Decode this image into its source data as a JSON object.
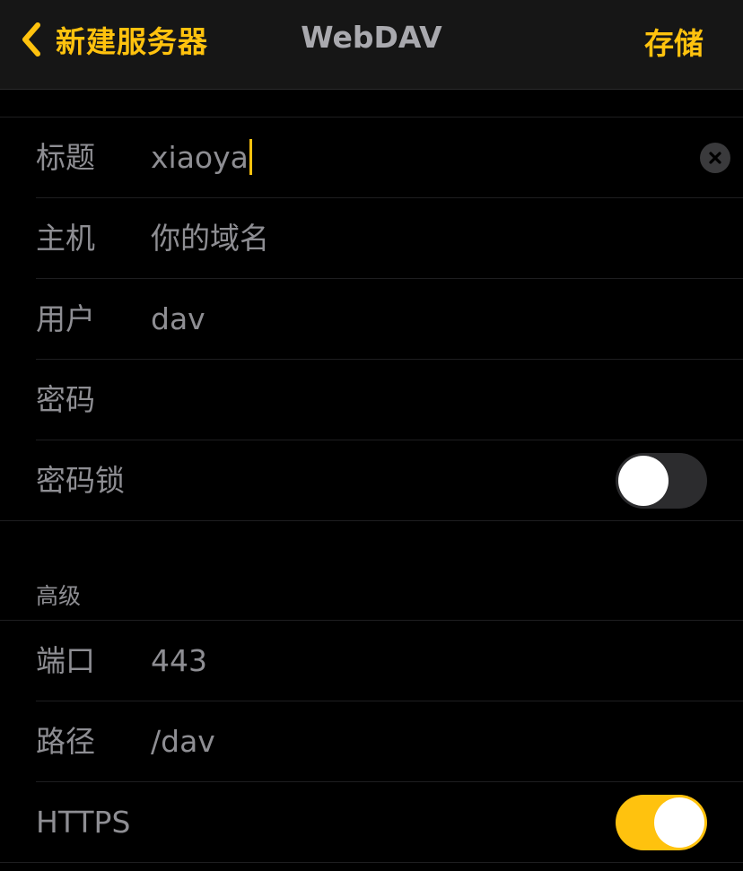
{
  "navbar": {
    "back_label": "新建服务器",
    "title": "WebDAV",
    "save_label": "存储"
  },
  "basic": {
    "title_row": {
      "label": "标题",
      "value": "xiaoya"
    },
    "host_row": {
      "label": "主机",
      "placeholder": "你的域名"
    },
    "user_row": {
      "label": "用户",
      "value": "dav"
    },
    "password_row": {
      "label": "密码",
      "value": ""
    },
    "passcode_lock_row": {
      "label": "密码锁",
      "enabled": false
    }
  },
  "advanced": {
    "header": "高级",
    "port_row": {
      "label": "端口",
      "value": "443"
    },
    "path_row": {
      "label": "路径",
      "value": "/dav"
    },
    "https_row": {
      "label": "HTTPS",
      "enabled": true
    }
  },
  "colors": {
    "accent": "#ffc20e",
    "background": "#000000",
    "navbar": "#161616",
    "text_secondary": "#8e8e93",
    "toggle_off": "#2c2c2e"
  },
  "icons": {
    "back": "chevron-left-icon",
    "clear": "clear-text-icon"
  }
}
